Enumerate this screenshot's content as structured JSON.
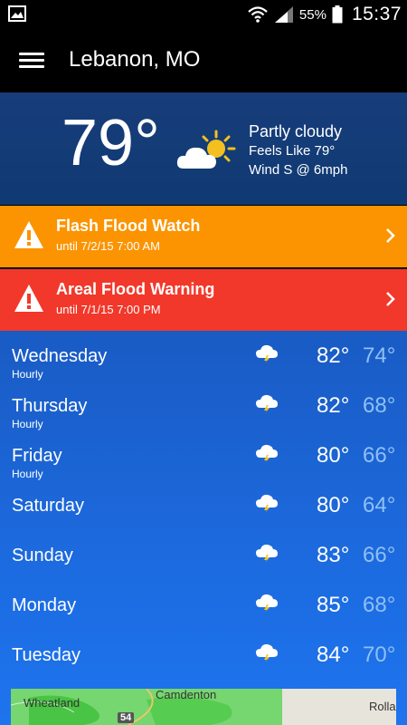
{
  "status_bar": {
    "battery_percent": "55%",
    "time": "15:37",
    "icons": [
      "gallery-icon",
      "wifi-icon",
      "signal-icon",
      "battery-icon"
    ]
  },
  "app_bar": {
    "location": "Lebanon, MO",
    "menu_icon": "menu-icon"
  },
  "current": {
    "temperature": "79°",
    "condition": "Partly cloudy",
    "feels_like": "Feels Like 79°",
    "wind": "Wind S @ 6mph",
    "icon": "partly-cloudy-icon"
  },
  "alerts": [
    {
      "title": "Flash Flood Watch",
      "until": "until 7/2/15 7:00 AM",
      "color": "#fb9400"
    },
    {
      "title": "Areal Flood Warning",
      "until": "until 7/1/15 7:00 PM",
      "color": "#f2382a"
    }
  ],
  "forecast": [
    {
      "day": "Wednesday",
      "hourly": "Hourly",
      "hi": "82°",
      "lo": "74°",
      "icon": "thunderstorm-icon"
    },
    {
      "day": "Thursday",
      "hourly": "Hourly",
      "hi": "82°",
      "lo": "68°",
      "icon": "thunderstorm-icon"
    },
    {
      "day": "Friday",
      "hourly": "Hourly",
      "hi": "80°",
      "lo": "66°",
      "icon": "thunderstorm-icon"
    },
    {
      "day": "Saturday",
      "hourly": "",
      "hi": "80°",
      "lo": "64°",
      "icon": "thunderstorm-icon"
    },
    {
      "day": "Sunday",
      "hourly": "",
      "hi": "83°",
      "lo": "66°",
      "icon": "thunderstorm-icon"
    },
    {
      "day": "Monday",
      "hourly": "",
      "hi": "85°",
      "lo": "68°",
      "icon": "thunderstorm-icon"
    },
    {
      "day": "Tuesday",
      "hourly": "",
      "hi": "84°",
      "lo": "70°",
      "icon": "thunderstorm-icon"
    }
  ],
  "map": {
    "labels": [
      "Camdenton",
      "Wheatland",
      "Rolla",
      "54"
    ]
  },
  "colors": {
    "header_bg": "#173d7a",
    "forecast_bg": "#1c6be0",
    "low_temp": "#8fc0f4",
    "watch": "#fb9400",
    "warning": "#f2382a"
  }
}
